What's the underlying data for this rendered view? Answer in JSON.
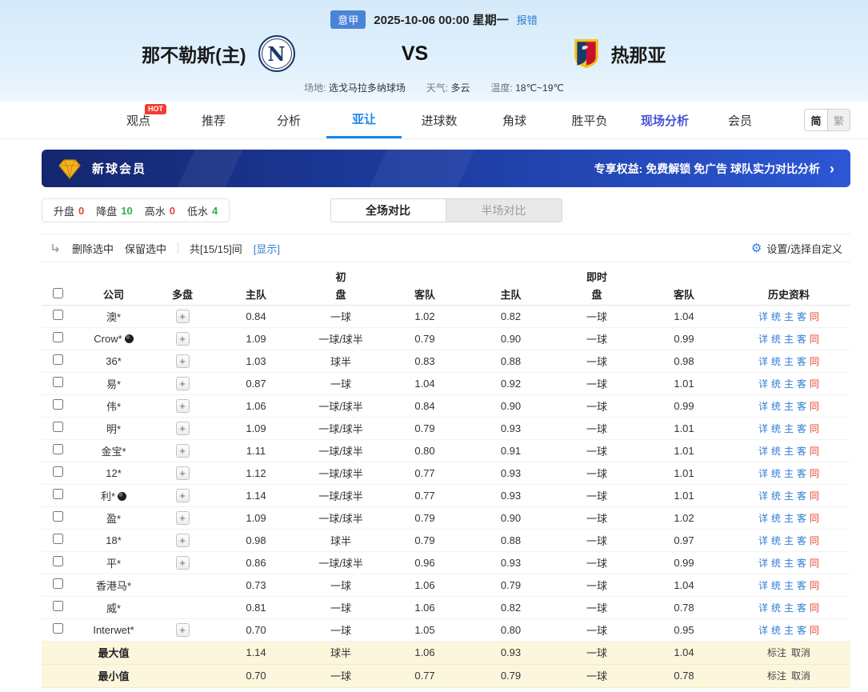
{
  "colors": {
    "accent_blue": "#1a88e8",
    "link_blue": "#2e7cd6",
    "red": "#e8442f",
    "green": "#2faf4e",
    "banner_blue": "#1d3b9e"
  },
  "icons": {
    "gear": "⚙",
    "arrow_right": "›",
    "plus": "+",
    "ball": "ball-icon",
    "diamond": "diamond-icon"
  },
  "meta": {
    "league_badge": "意甲",
    "datetime": "2025-10-06 00:00 星期一",
    "report_error": "报错",
    "home_team": "那不勒斯(主)",
    "home_logo_letter": "N",
    "vs": "VS",
    "away_team": "热那亚",
    "venue_label": "场地:",
    "venue": "选戈马拉多纳球场",
    "weather_label": "天气:",
    "weather": "多云",
    "temp_label": "温度:",
    "temp": "18℃~19℃"
  },
  "nav": {
    "hot_label": "HOT",
    "tabs": [
      {
        "label": "观点"
      },
      {
        "label": "推荐"
      },
      {
        "label": "分析"
      },
      {
        "label": "亚让"
      },
      {
        "label": "进球数"
      },
      {
        "label": "角球"
      },
      {
        "label": "胜平负"
      },
      {
        "label": "现场分析"
      },
      {
        "label": "会员"
      }
    ],
    "lang_simplified": "简",
    "lang_traditional": "繁"
  },
  "banner": {
    "title": "新球会员",
    "benefits": "专享权益: 免费解锁 免广告 球队实力对比分析",
    "arrow": "›"
  },
  "filters": {
    "items": [
      {
        "label": "升盘",
        "value": "0",
        "color": "red"
      },
      {
        "label": "降盘",
        "value": "10",
        "color": "green"
      },
      {
        "label": "高水",
        "value": "0",
        "color": "red"
      },
      {
        "label": "低水",
        "value": "4",
        "color": "green"
      }
    ],
    "full_match": "全场对比",
    "half_match": "半场对比"
  },
  "toolbar": {
    "delete_selected": "删除选中",
    "keep_selected": "保留选中",
    "count_text": "共[15/15]间",
    "show_link": "[显示]",
    "settings": "设置/选择自定义"
  },
  "table": {
    "group_initial": "初",
    "group_live": "即时",
    "headers": {
      "company": "公司",
      "multi": "多盘",
      "home": "主队",
      "handicap": "盘",
      "away": "客队",
      "history": "历史资料"
    },
    "history_links": [
      "详",
      "统",
      "主",
      "客",
      "同"
    ],
    "summary_links": [
      "标注",
      "取消"
    ],
    "rows": [
      {
        "company": "澳*",
        "ball_icon": false,
        "multi": true,
        "init_home": "0.84",
        "init_hcp": "一球",
        "init_away": "1.02",
        "live_home": "0.82",
        "live_hcp": "一球",
        "live_away": "1.04"
      },
      {
        "company": "Crow*",
        "ball_icon": true,
        "multi": true,
        "init_home": "1.09",
        "init_hcp": "一球/球半",
        "init_away": "0.79",
        "live_home": "0.90",
        "live_hcp": "一球",
        "live_away": "0.99"
      },
      {
        "company": "36*",
        "ball_icon": false,
        "multi": true,
        "init_home": "1.03",
        "init_hcp": "球半",
        "init_away": "0.83",
        "live_home": "0.88",
        "live_hcp": "一球",
        "live_away": "0.98"
      },
      {
        "company": "易*",
        "ball_icon": false,
        "multi": true,
        "init_home": "0.87",
        "init_hcp": "一球",
        "init_away": "1.04",
        "live_home": "0.92",
        "live_hcp": "一球",
        "live_away": "1.01"
      },
      {
        "company": "伟*",
        "ball_icon": false,
        "multi": true,
        "init_home": "1.06",
        "init_hcp": "一球/球半",
        "init_away": "0.84",
        "live_home": "0.90",
        "live_hcp": "一球",
        "live_away": "0.99"
      },
      {
        "company": "明*",
        "ball_icon": false,
        "multi": true,
        "init_home": "1.09",
        "init_hcp": "一球/球半",
        "init_away": "0.79",
        "live_home": "0.93",
        "live_hcp": "一球",
        "live_away": "1.01"
      },
      {
        "company": "金宝*",
        "ball_icon": false,
        "multi": true,
        "init_home": "1.11",
        "init_hcp": "一球/球半",
        "init_away": "0.80",
        "live_home": "0.91",
        "live_hcp": "一球",
        "live_away": "1.01"
      },
      {
        "company": "12*",
        "ball_icon": false,
        "multi": true,
        "init_home": "1.12",
        "init_hcp": "一球/球半",
        "init_away": "0.77",
        "live_home": "0.93",
        "live_hcp": "一球",
        "live_away": "1.01"
      },
      {
        "company": "利*",
        "ball_icon": true,
        "multi": true,
        "init_home": "1.14",
        "init_hcp": "一球/球半",
        "init_away": "0.77",
        "live_home": "0.93",
        "live_hcp": "一球",
        "live_away": "1.01"
      },
      {
        "company": "盈*",
        "ball_icon": false,
        "multi": true,
        "init_home": "1.09",
        "init_hcp": "一球/球半",
        "init_away": "0.79",
        "live_home": "0.90",
        "live_hcp": "一球",
        "live_away": "1.02"
      },
      {
        "company": "18*",
        "ball_icon": false,
        "multi": true,
        "init_home": "0.98",
        "init_hcp": "球半",
        "init_away": "0.79",
        "live_home": "0.88",
        "live_hcp": "一球",
        "live_away": "0.97"
      },
      {
        "company": "平*",
        "ball_icon": false,
        "multi": true,
        "init_home": "0.86",
        "init_hcp": "一球/球半",
        "init_away": "0.96",
        "live_home": "0.93",
        "live_hcp": "一球",
        "live_away": "0.99"
      },
      {
        "company": "香港马*",
        "ball_icon": false,
        "multi": false,
        "init_home": "0.73",
        "init_hcp": "一球",
        "init_away": "1.06",
        "live_home": "0.79",
        "live_hcp": "一球",
        "live_away": "1.04"
      },
      {
        "company": "威*",
        "ball_icon": false,
        "multi": false,
        "init_home": "0.81",
        "init_hcp": "一球",
        "init_away": "1.06",
        "live_home": "0.82",
        "live_hcp": "一球",
        "live_away": "0.78"
      },
      {
        "company": "Interwet*",
        "ball_icon": false,
        "multi": true,
        "init_home": "0.70",
        "init_hcp": "一球",
        "init_away": "1.05",
        "live_home": "0.80",
        "live_hcp": "一球",
        "live_away": "0.95"
      }
    ],
    "summary": [
      {
        "label": "最大值",
        "init_home": "1.14",
        "init_hcp": "球半",
        "init_away": "1.06",
        "live_home": "0.93",
        "live_hcp": "一球",
        "live_away": "1.04"
      },
      {
        "label": "最小值",
        "init_home": "0.70",
        "init_hcp": "一球",
        "init_away": "0.77",
        "live_home": "0.79",
        "live_hcp": "一球",
        "live_away": "0.78"
      }
    ]
  }
}
